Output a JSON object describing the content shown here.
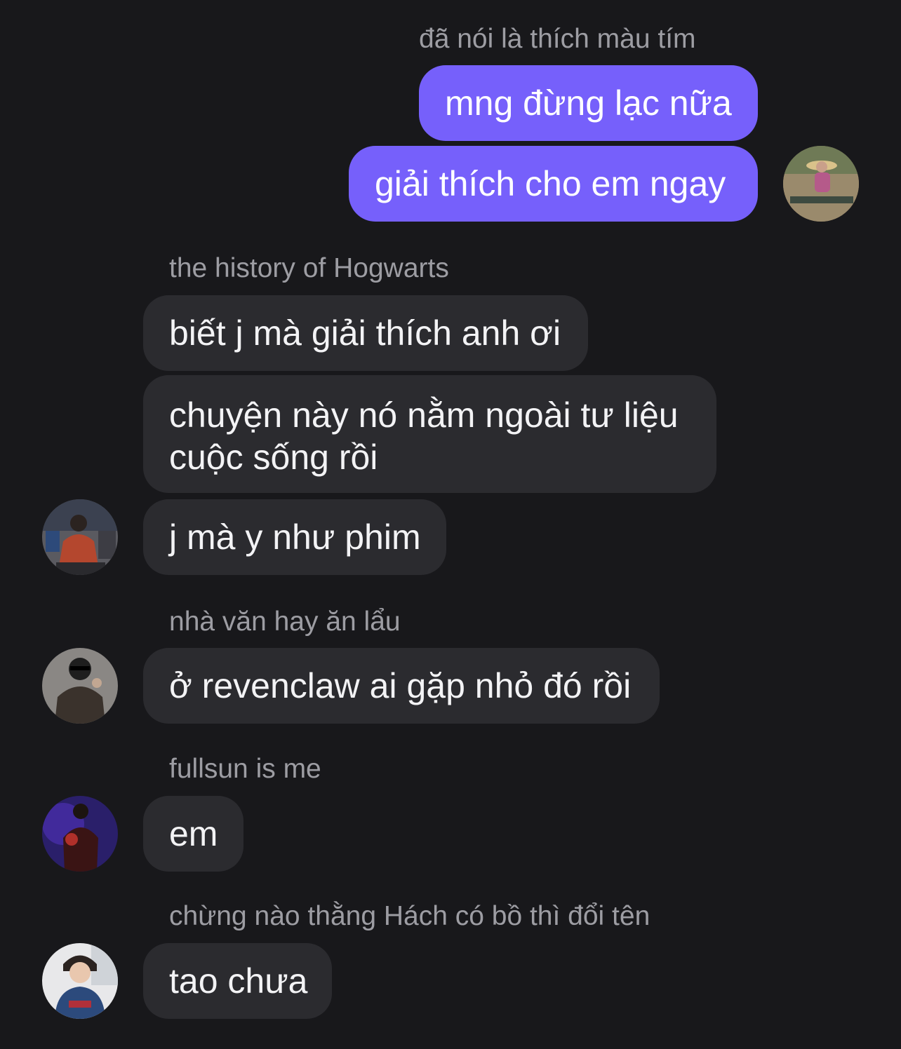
{
  "chat": {
    "outgoing": {
      "name": "đã nói là thích màu tím",
      "messages": [
        "mng đừng lạc nữa",
        "giải thích cho em ngay"
      ]
    },
    "group1": {
      "name": "the history of Hogwarts",
      "messages": [
        "biết j mà giải thích anh ơi",
        "chuyện này nó nằm ngoài tư liệu cuộc sống rồi",
        "j mà y như phim"
      ]
    },
    "group2": {
      "name": "nhà văn hay ăn lẩu",
      "messages": [
        "ở revenclaw ai gặp nhỏ đó rồi"
      ]
    },
    "group3": {
      "name": "fullsun is me",
      "messages": [
        "em"
      ]
    },
    "group4": {
      "name": "chừng nào thằng Hách có bồ thì đổi tên",
      "messages": [
        "tao chưa"
      ]
    }
  },
  "colors": {
    "background": "#18181b",
    "incoming_bubble": "#2b2b2f",
    "outgoing_bubble": "#7660fb",
    "sender_name": "#9d9da3"
  }
}
